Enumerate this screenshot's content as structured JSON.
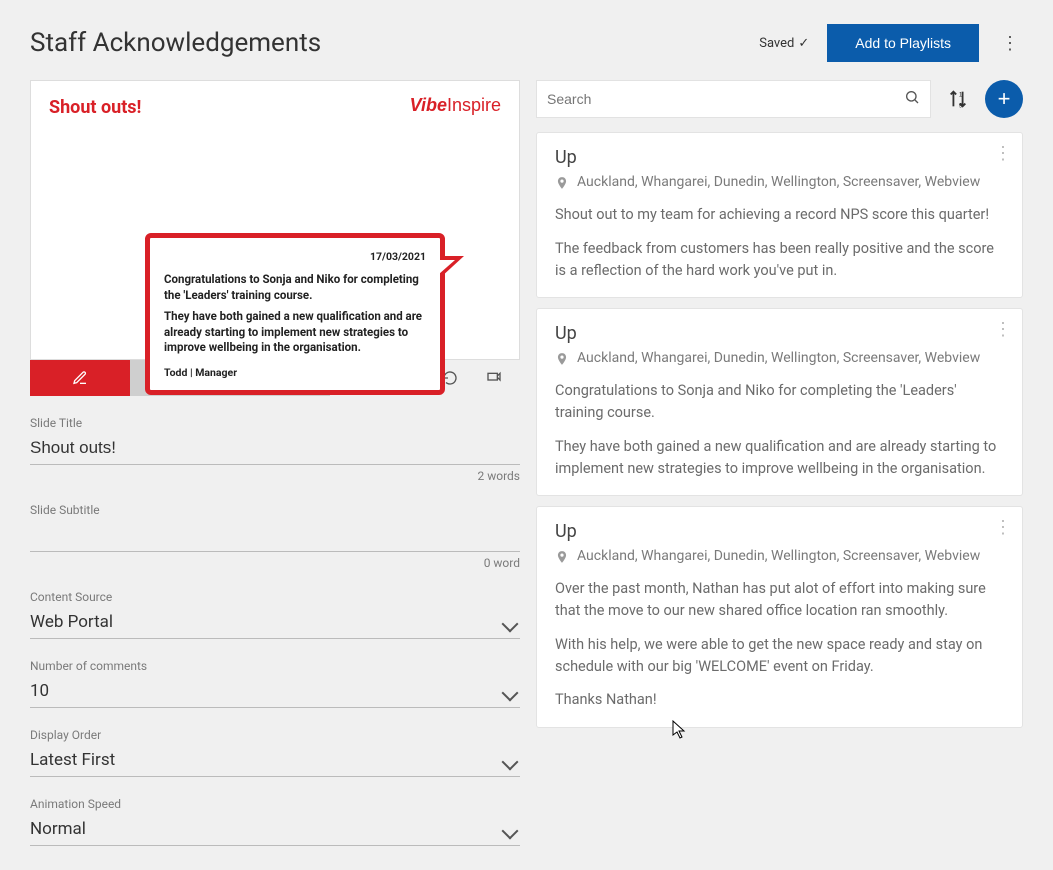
{
  "header": {
    "title": "Staff Acknowledgements",
    "saved_label": "Saved",
    "add_playlist_label": "Add to Playlists"
  },
  "slide": {
    "heading": "Shout outs!",
    "logo_vibe": "Vibe",
    "logo_inspire": "Inspire",
    "date": "17/03/2021",
    "p1": "Congratulations to Sonja and Niko for completing the 'Leaders' training course.",
    "p2": "They have both gained a new qualification and are already starting to implement new strategies to improve wellbeing in the organisation.",
    "author": "Todd | Manager"
  },
  "form": {
    "slide_title_label": "Slide Title",
    "slide_title_value": "Shout outs!",
    "slide_title_count": "2 words",
    "slide_subtitle_label": "Slide Subtitle",
    "slide_subtitle_value": "",
    "slide_subtitle_count": "0 word",
    "content_source_label": "Content Source",
    "content_source_value": "Web Portal",
    "num_comments_label": "Number of comments",
    "num_comments_value": "10",
    "display_order_label": "Display Order",
    "display_order_value": "Latest First",
    "anim_speed_label": "Animation Speed",
    "anim_speed_value": "Normal"
  },
  "search": {
    "placeholder": "Search"
  },
  "cards": [
    {
      "title": "Up",
      "location": "Auckland, Whangarei, Dunedin, Wellington, Screensaver, Webview",
      "paras": [
        "Shout out to my team for achieving a record NPS score this quarter!",
        "The feedback from customers has been really positive and the score is a reflection of the hard work you've put in."
      ]
    },
    {
      "title": "Up",
      "location": "Auckland, Whangarei, Dunedin, Wellington, Screensaver, Webview",
      "paras": [
        "Congratulations to Sonja and Niko for completing the 'Leaders' training course.",
        "They have both gained a new qualification and are already starting to implement new strategies to improve wellbeing in the organisation."
      ]
    },
    {
      "title": "Up",
      "location": "Auckland, Whangarei, Dunedin, Wellington, Screensaver, Webview",
      "paras": [
        "Over the past month, Nathan has put alot of effort into making sure that the move to our new shared office location ran smoothly.",
        "With his help, we were able to get the new space ready and stay on schedule with our big 'WELCOME' event on Friday.",
        "Thanks Nathan!"
      ]
    }
  ]
}
